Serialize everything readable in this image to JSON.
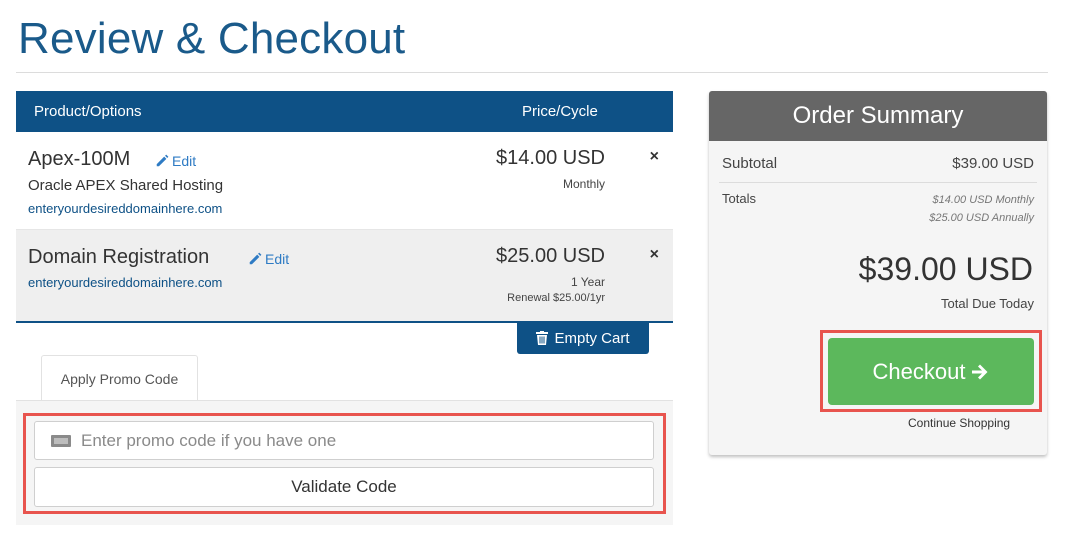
{
  "page": {
    "title": "Review & Checkout"
  },
  "cart": {
    "header": {
      "product": "Product/Options",
      "price": "Price/Cycle"
    },
    "items": [
      {
        "name": "Apex-100M",
        "edit": "Edit",
        "description": "Oracle APEX Shared Hosting",
        "domain": "enteryourdesireddomainhere.com",
        "price": "$14.00 USD",
        "cycle": "Monthly",
        "renewal": ""
      },
      {
        "name": "Domain Registration",
        "edit": "Edit",
        "description": "",
        "domain": "enteryourdesireddomainhere.com",
        "price": "$25.00 USD",
        "cycle": "1 Year",
        "renewal": "Renewal $25.00/1yr"
      }
    ],
    "remove_symbol": "×",
    "empty_cart": "Empty Cart"
  },
  "promo": {
    "tab": "Apply Promo Code",
    "placeholder": "Enter promo code if you have one",
    "validate": "Validate Code"
  },
  "summary": {
    "title": "Order Summary",
    "subtotal_label": "Subtotal",
    "subtotal_value": "$39.00 USD",
    "totals_label": "Totals",
    "totals_monthly": "$14.00 USD Monthly",
    "totals_annually": "$25.00 USD Annually",
    "total_due": "$39.00 USD",
    "total_due_label": "Total Due Today",
    "checkout": "Checkout",
    "continue": "Continue Shopping"
  },
  "colors": {
    "brand": "#0e5186",
    "checkout": "#5cb85c",
    "highlight": "#e8544e",
    "summary_header": "#666666"
  }
}
